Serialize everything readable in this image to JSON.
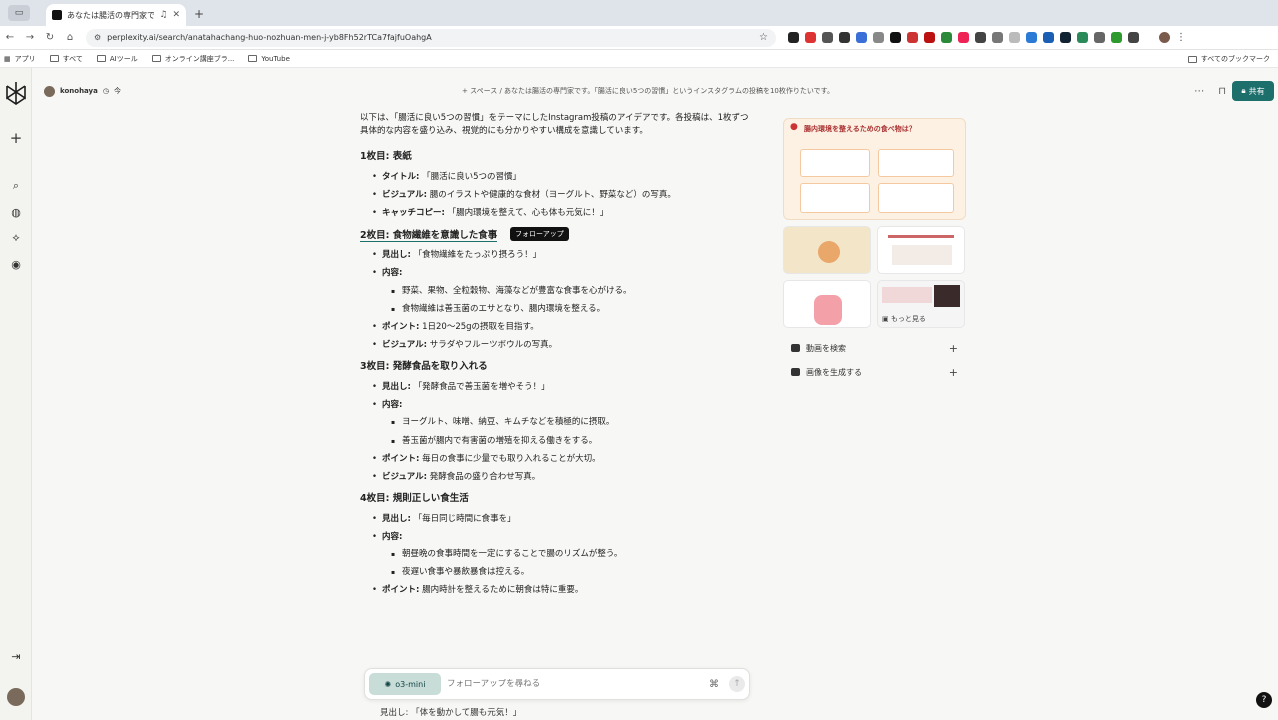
{
  "browser": {
    "tab_title": "あなたは腸活の専門家です。",
    "url": "perplexity.ai/search/anatahachang-huo-nozhuan-men-j-yb8Fh52rTCa7fajfuOahgA",
    "bookmarks": [
      "アプリ",
      "すべて",
      "AIツール",
      "オンライン講座ブラ...",
      "YouTube"
    ],
    "bookmarks_right": "すべてのブックマーク"
  },
  "header": {
    "user": "konohaya",
    "time": "今",
    "breadcrumb": "+ スペース / あなたは腸活の専門家です。「腸活に良い5つの習慣」というインスタグラムの投稿を10枚作りたいです。",
    "share_label": "共有"
  },
  "answer": {
    "intro": "以下は、「腸活に良い5つの習慣」をテーマにしたInstagram投稿のアイデアです。各投稿は、1枚ずつ具体的な内容を盛り込み、視覚的にも分かりやすい構成を意識しています。",
    "tooltip": "フォローアップ",
    "sections": [
      {
        "heading": "1枚目: 表紙",
        "items": [
          {
            "label": "タイトル:",
            "text": " 「腸活に良い5つの習慣」"
          },
          {
            "label": "ビジュアル:",
            "text": " 腸のイラストや健康的な食材（ヨーグルト、野菜など）の写真。"
          },
          {
            "label": "キャッチコピー:",
            "text": " 「腸内環境を整えて、心も体も元気に！」"
          }
        ]
      },
      {
        "heading": "2枚目: 食物繊維を意識した食事",
        "items": [
          {
            "label": "見出し:",
            "text": " 「食物繊維をたっぷり摂ろう！」"
          },
          {
            "label": "内容:",
            "text": "",
            "sub": [
              "野菜、果物、全粒穀物、海藻などが豊富な食事を心がける。",
              "食物繊維は善玉菌のエサとなり、腸内環境を整える。"
            ]
          },
          {
            "label": "ポイント:",
            "text": " 1日20〜25gの摂取を目指す。"
          },
          {
            "label": "ビジュアル:",
            "text": " サラダやフルーツボウルの写真。"
          }
        ]
      },
      {
        "heading": "3枚目: 発酵食品を取り入れる",
        "items": [
          {
            "label": "見出し:",
            "text": " 「発酵食品で善玉菌を増やそう！」"
          },
          {
            "label": "内容:",
            "text": "",
            "sub": [
              "ヨーグルト、味噌、納豆、キムチなどを積極的に摂取。",
              "善玉菌が腸内で有害菌の増殖を抑える働きをする。"
            ]
          },
          {
            "label": "ポイント:",
            "text": " 毎日の食事に少量でも取り入れることが大切。"
          },
          {
            "label": "ビジュアル:",
            "text": " 発酵食品の盛り合わせ写真。"
          }
        ]
      },
      {
        "heading": "4枚目: 規則正しい食生活",
        "items": [
          {
            "label": "見出し:",
            "text": " 「毎日同じ時間に食事を」"
          },
          {
            "label": "内容:",
            "text": "",
            "sub": [
              "朝昼晩の食事時間を一定にすることで腸のリズムが整う。",
              "夜遅い食事や暴飲暴食は控える。"
            ]
          },
          {
            "label": "ポイント:",
            "text": " 腸内時計を整えるために朝食は特に重要。"
          }
        ]
      }
    ],
    "cutoff": "見出し: 「体を動かして腸も元気！」"
  },
  "media": {
    "main_caption": "腸内環境を整えるための食べ物は？",
    "more_label": "もっと見る",
    "video_search": "動画を検索",
    "image_generate": "画像を生成する"
  },
  "followup": {
    "model": "o3-mini",
    "placeholder": "フォローアップを尋ねる"
  },
  "colors": {
    "accent": "#1d6f6b",
    "background": "#f7f7f5"
  }
}
